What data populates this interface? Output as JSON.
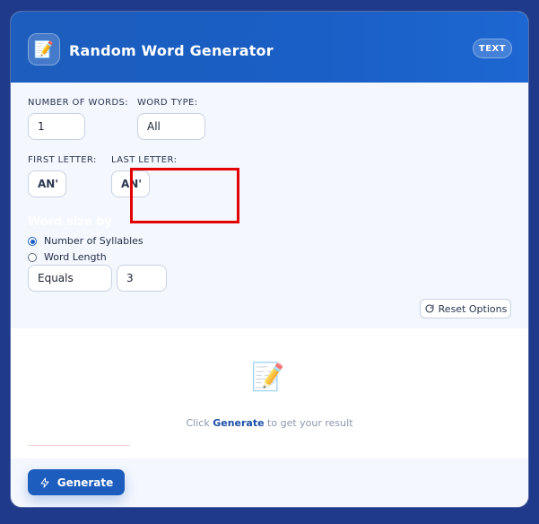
{
  "header": {
    "title": "Random Word Generator",
    "badge": "TEXT"
  },
  "options": {
    "number_of_words": {
      "label": "NUMBER OF WORDS:",
      "value": "1"
    },
    "word_type": {
      "label": "WORD TYPE:",
      "value": "All"
    },
    "first_letter": {
      "label": "FIRST LETTER:",
      "value": "AN'"
    },
    "last_letter": {
      "label": "LAST LETTER:",
      "value": "AN'"
    },
    "word_size_title": "Word size by",
    "word_size_mode": {
      "options": [
        "Number of Syllables",
        "Word Length"
      ],
      "selected": "Number of Syllables"
    },
    "comparison": {
      "value": "Equals"
    },
    "size_value": {
      "value": "3"
    },
    "reset_label": "Reset Options"
  },
  "result": {
    "text_prefix": "Click ",
    "text_link": "Generate",
    "text_suffix": " to get your result"
  },
  "footer": {
    "generate_label": "Generate"
  },
  "colors": {
    "background": "#1f3a8a",
    "header": "#1c5dbd",
    "accent": "#1c5dbd",
    "highlight": "#e30000"
  },
  "icons": {
    "app": "notepad-pencil-icon",
    "result": "notepad-pencil-icon",
    "reset": "refresh-icon",
    "generate": "bolt-icon"
  }
}
